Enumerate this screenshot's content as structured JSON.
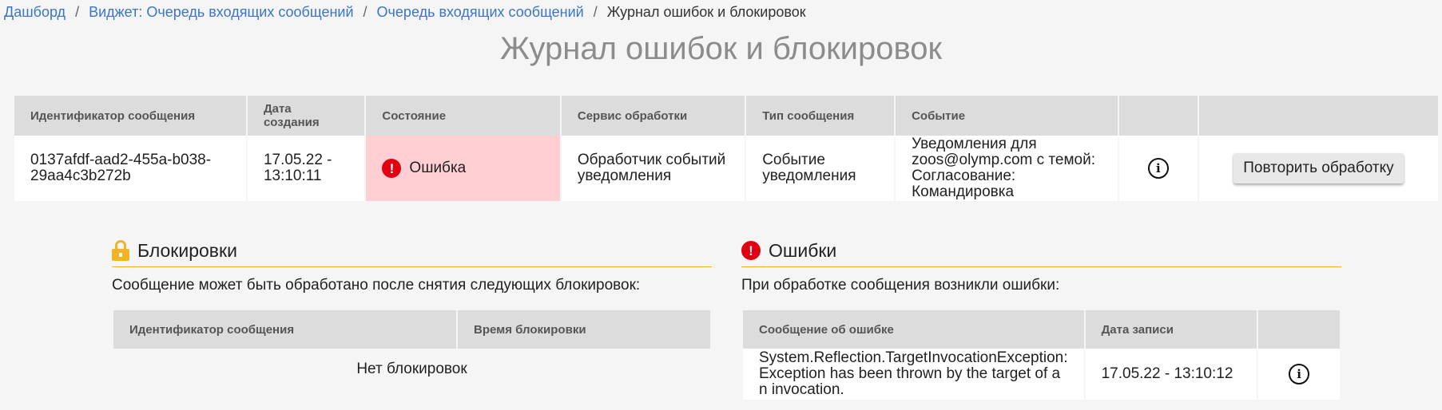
{
  "breadcrumb": {
    "items": [
      "Дашборд",
      "Виджет: Очередь входящих сообщений",
      "Очередь входящих сообщений"
    ],
    "separator": "/",
    "current": "Журнал ошибок и блокировок"
  },
  "page_title": "Журнал ошибок и блокировок",
  "main_table": {
    "headers": [
      "Идентификатор сообщения",
      "Дата создания",
      "Состояние",
      "Сервис обработки",
      "Тип сообщения",
      "Событие",
      "",
      ""
    ],
    "row": {
      "id": "0137afdf-aad2-455a-b038-29aa4c3b272b",
      "created": "17.05.22 - 13:10:11",
      "state": "Ошибка",
      "service": "Обработчик событий уведомления",
      "type": "Событие уведомления",
      "event": "Уведомления для zoos@olymp.com с темой: Согласование: Командировка",
      "info_icon": "info-icon",
      "retry_label": "Повторить обработку"
    }
  },
  "locks": {
    "title": "Блокировки",
    "icon": "lock-icon",
    "description": "Сообщение может быть обработано после снятия следующих блокировок:",
    "headers": [
      "Идентификатор сообщения",
      "Время блокировки"
    ],
    "empty": "Нет блокировок"
  },
  "errors": {
    "title": "Ошибки",
    "icon": "error-icon",
    "description": "При обработке сообщения возникли ошибки:",
    "headers": [
      "Сообщение об ошибке",
      "Дата записи",
      ""
    ],
    "rows": [
      {
        "message": "System.Reflection.TargetInvocationException: Exception has been thrown by the target of an invocation.",
        "date": "17.05.22 - 13:10:12",
        "info_icon": "info-icon"
      }
    ]
  },
  "colors": {
    "link": "#3a76c4",
    "title": "#8c8c8c",
    "header_bg": "#dcdcdc",
    "error_bg": "#ffcfd4",
    "error_red": "#e00012",
    "accent_yellow": "#f0b428"
  }
}
